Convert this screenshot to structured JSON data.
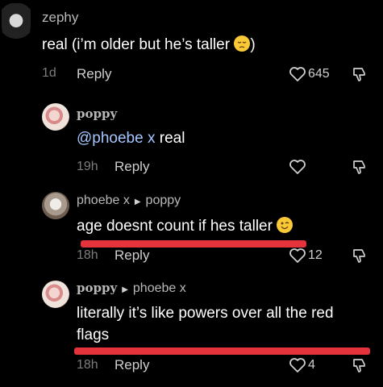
{
  "comments": [
    {
      "username": "zephy",
      "text_before": "real (i’m older but he’s taller",
      "emoji": "pensive-face",
      "text_after": ")",
      "time": "1d",
      "reply_label": "Reply",
      "like_count": "645"
    },
    {
      "username": "poppy",
      "mention": "@phoebe x",
      "text": " real",
      "time": "19h",
      "reply_label": "Reply",
      "like_count": ""
    },
    {
      "username": "phoebe x",
      "reply_to": "poppy",
      "text": "age doesnt count if hes taller",
      "emoji": "winking-face",
      "time": "18h",
      "reply_label": "Reply",
      "like_count": "12"
    },
    {
      "username": "poppy",
      "reply_to": "phoebe x",
      "text_line1": "literally it’s like powers over all the red",
      "text_line2": "flags",
      "time": "18h",
      "reply_label": "Reply",
      "like_count": "4"
    }
  ],
  "colors": {
    "background": "#000000",
    "highlight_bar": "#e5333b",
    "mention": "#a7c6ff"
  }
}
